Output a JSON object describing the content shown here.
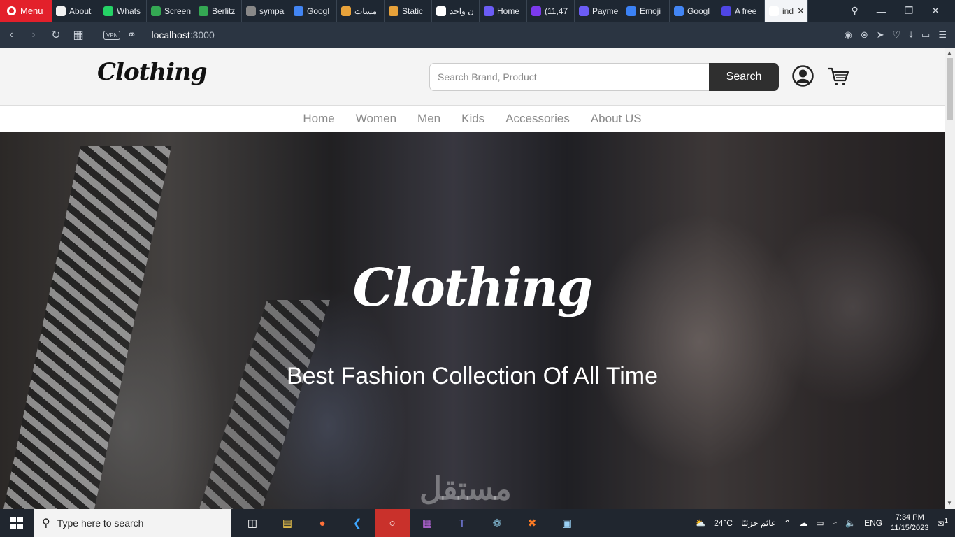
{
  "browser": {
    "menu_label": "Menu",
    "tabs": [
      {
        "label": "About",
        "fav_color": "#f1f1f1"
      },
      {
        "label": "Whats",
        "fav_color": "#25d366"
      },
      {
        "label": "Screen",
        "fav_color": "#34a853"
      },
      {
        "label": "Berlitz",
        "fav_color": "#34a853"
      },
      {
        "label": "sympa",
        "fav_color": "#888888"
      },
      {
        "label": "Googl",
        "fav_color": "#4285f4"
      },
      {
        "label": "مسات",
        "fav_color": "#e8a23a"
      },
      {
        "label": "Static",
        "fav_color": "#e8a23a"
      },
      {
        "label": "ن واحد",
        "fav_color": "#ffffff"
      },
      {
        "label": "Home",
        "fav_color": "#6b5cf6"
      },
      {
        "label": "(11,47",
        "fav_color": "#7c3aed"
      },
      {
        "label": "Payme",
        "fav_color": "#6b5cf6"
      },
      {
        "label": "Emoji",
        "fav_color": "#3b82f6"
      },
      {
        "label": "Googl",
        "fav_color": "#4285f4"
      },
      {
        "label": "A free",
        "fav_color": "#4f46e5"
      },
      {
        "label": "ind",
        "fav_color": "#ffffff"
      }
    ],
    "vpn_label": "VPN",
    "url_host": "localhost",
    "url_port": ":3000"
  },
  "site": {
    "logo_text": "Clothing",
    "search": {
      "placeholder": "Search Brand, Product",
      "button_label": "Search"
    },
    "nav": [
      {
        "label": "Home"
      },
      {
        "label": "Women"
      },
      {
        "label": "Men"
      },
      {
        "label": "Kids"
      },
      {
        "label": "Accessories"
      },
      {
        "label": "About US"
      }
    ],
    "hero": {
      "logo_text": "Clothing",
      "tagline": "Best Fashion Collection Of All Time"
    },
    "watermark": "مستقل"
  },
  "taskbar": {
    "search_placeholder": "Type here to search",
    "weather_temp": "24°C",
    "weather_text": "غائم جزئيًا",
    "language": "ENG",
    "time": "7:34 PM",
    "date": "11/15/2023",
    "notification_count": "1"
  }
}
